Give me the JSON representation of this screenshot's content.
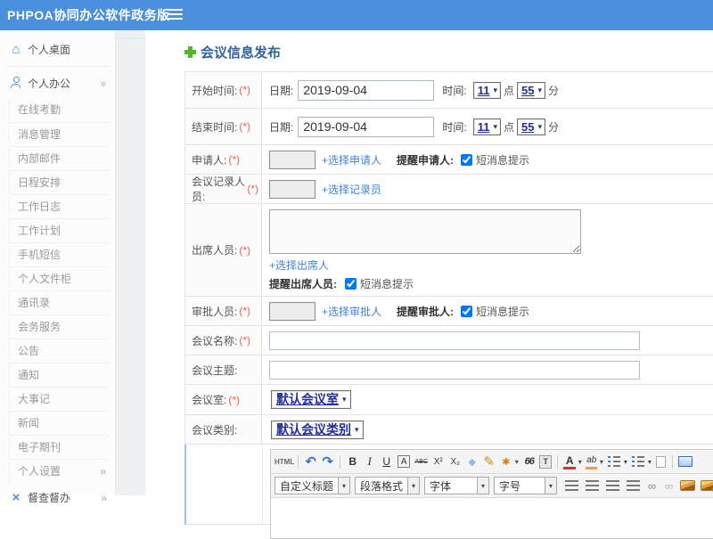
{
  "topbar": {
    "title": "PHPOA协同办公软件政务版"
  },
  "colors": {
    "header_blue": "#4a90dc",
    "link_blue": "#3f85d6",
    "required_red": "#f55a4e",
    "select_navy": "#232e9b",
    "sidebar_icon_blue": "#4a90d9",
    "supervise_pink": "#ee7f9a",
    "plus_green": "#55b42e",
    "title_blue": "#33639c"
  },
  "sidebar": {
    "desktop": {
      "label": "个人桌面"
    },
    "office": {
      "label": "个人办公"
    },
    "sub_items": [
      {
        "name": "sidebar-item-online-attendance",
        "label": "在线考勤"
      },
      {
        "name": "sidebar-item-message-management",
        "label": "消息管理"
      },
      {
        "name": "sidebar-item-internal-mail",
        "label": "内部邮件"
      },
      {
        "name": "sidebar-item-schedule",
        "label": "日程安排"
      },
      {
        "name": "sidebar-item-work-log",
        "label": "工作日志"
      },
      {
        "name": "sidebar-item-work-plan",
        "label": "工作计划"
      },
      {
        "name": "sidebar-item-mobile-sms",
        "label": "手机短信"
      },
      {
        "name": "sidebar-item-personal-cabinet",
        "label": "个人文件柜"
      },
      {
        "name": "sidebar-item-contacts",
        "label": "通讯录"
      },
      {
        "name": "sidebar-item-meeting-service",
        "label": "会务服务"
      },
      {
        "name": "sidebar-item-announcement",
        "label": "公告"
      },
      {
        "name": "sidebar-item-notice",
        "label": "通知"
      },
      {
        "name": "sidebar-item-memorabilia",
        "label": "大事记"
      },
      {
        "name": "sidebar-item-news",
        "label": "新闻"
      },
      {
        "name": "sidebar-item-e-journal",
        "label": "电子期刊"
      }
    ],
    "settings": {
      "label": "个人设置"
    },
    "supervise": {
      "label": "督查督办"
    }
  },
  "page": {
    "title": "会议信息发布"
  },
  "form": {
    "start_time": {
      "label": "开始时间:",
      "required": "(*)",
      "date_label": "日期:",
      "date_value": "2019-09-04",
      "time_label": "时间:",
      "hour": "11",
      "hour_unit": "点",
      "minute": "55",
      "minute_unit": "分"
    },
    "end_time": {
      "label": "结束时间:",
      "required": "(*)",
      "date_label": "日期:",
      "date_value": "2019-09-04",
      "time_label": "时间:",
      "hour": "11",
      "hour_unit": "点",
      "minute": "55",
      "minute_unit": "分"
    },
    "applicant": {
      "label": "申请人:",
      "required": "(*)",
      "value": "",
      "link": "+选择申请人",
      "remind_label": "提醒申请人:",
      "sms_label": "短消息提示",
      "checked": true
    },
    "recorder": {
      "label": "会议记录人员:",
      "required": "(*)",
      "value": "",
      "link": "+选择记录员"
    },
    "attendees": {
      "label": "出席人员:",
      "required": "(*)",
      "value": "",
      "link": "+选择出席人",
      "remind_label": "提醒出席人员:",
      "sms_label": "短消息提示",
      "checked": true
    },
    "approver": {
      "label": "审批人员:",
      "required": "(*)",
      "value": "",
      "link": "+选择审批人",
      "remind_label": "提醒审批人:",
      "sms_label": "短消息提示",
      "checked": true
    },
    "meeting_name": {
      "label": "会议名称:",
      "required": "(*)",
      "value": ""
    },
    "meeting_subject": {
      "label": "会议主题:",
      "value": ""
    },
    "meeting_room": {
      "label": "会议室:",
      "required": "(*)",
      "value": "默认会议室"
    },
    "meeting_category": {
      "label": "会议类别:",
      "value": "默认会议类别"
    }
  },
  "editor": {
    "selects": {
      "heading": "自定义标题",
      "paragraph": "段落格式",
      "font": "字体",
      "size": "字号"
    },
    "toolbar_row1": [
      {
        "name": "html-source-button",
        "glyph": "HTML",
        "cls": "tb-html"
      },
      {
        "type": "sep",
        "name": "toolbar-separator"
      },
      {
        "name": "undo-icon",
        "glyph": "↶",
        "cls": "tb-big",
        "color": "#2f6fc1"
      },
      {
        "name": "redo-icon",
        "glyph": "↷",
        "cls": "tb-big",
        "color": "#2f6fc1"
      },
      {
        "type": "sep",
        "name": "toolbar-separator"
      },
      {
        "name": "bold-icon",
        "glyph": "B",
        "cls": "tb-b"
      },
      {
        "name": "italic-icon",
        "glyph": "I",
        "cls": "tb-i"
      },
      {
        "name": "underline-icon",
        "glyph": "U",
        "cls": "tb-u"
      },
      {
        "name": "font-style-icon",
        "glyph": "A",
        "cls": "tb-boxA"
      },
      {
        "name": "strikethrough-icon",
        "glyph": "ABC",
        "cls": "tb-strike"
      },
      {
        "name": "superscript-icon",
        "glyph": "X²",
        "cls": "tb-small"
      },
      {
        "name": "subscript-icon",
        "glyph": "X₂",
        "cls": "tb-small"
      },
      {
        "name": "eraser-icon",
        "glyph": "◆",
        "color": "#93b9e2"
      },
      {
        "name": "format-brush-icon",
        "glyph": "✎",
        "cls": "tb-big",
        "color": "#cf8a1d"
      },
      {
        "name": "quick-format-icon",
        "glyph": "✱",
        "color": "#e07820"
      },
      {
        "name": "quick-format-caret",
        "glyph": "▾",
        "cls": "tb-caret"
      },
      {
        "name": "blockquote-icon",
        "glyph": "66",
        "cls": "tb-quote"
      },
      {
        "name": "paste-icon",
        "glyph": "T",
        "cls": "ic-paste"
      },
      {
        "type": "sep",
        "name": "toolbar-separator"
      },
      {
        "name": "font-color-icon",
        "glyph": "A",
        "cls": "tb-Acolor"
      },
      {
        "name": "font-color-caret",
        "glyph": "▾",
        "cls": "tb-caret"
      },
      {
        "name": "highlight-icon",
        "glyph": "ab",
        "cls": "tb-ab"
      },
      {
        "name": "highlight-caret",
        "glyph": "▾",
        "cls": "tb-caret"
      },
      {
        "name": "ordered-list-icon",
        "cls": "ic-olist"
      },
      {
        "name": "ordered-list-caret",
        "glyph": "▾",
        "cls": "tb-caret"
      },
      {
        "name": "unordered-list-icon",
        "cls": "ic-ulist"
      },
      {
        "name": "unordered-list-caret",
        "glyph": "▾",
        "cls": "tb-caret"
      },
      {
        "name": "new-page-icon",
        "cls": "ic-page"
      },
      {
        "type": "sep",
        "name": "toolbar-separator"
      },
      {
        "name": "fullscreen-icon",
        "cls": "ic-screen"
      }
    ],
    "toolbar_row2_icons": [
      {
        "name": "align-left-icon",
        "cls": "ic-align"
      },
      {
        "name": "align-center-icon",
        "cls": "ic-align"
      },
      {
        "name": "align-right-icon",
        "cls": "ic-align"
      },
      {
        "name": "align-justify-icon",
        "cls": "ic-align"
      },
      {
        "name": "link-icon",
        "glyph": "∞",
        "cls": "ic-link"
      },
      {
        "name": "unlink-icon",
        "glyph": "∞",
        "cls": "ic-link tb-dim"
      },
      {
        "name": "image-icon",
        "cls": "ic-img"
      },
      {
        "name": "image-upload-icon",
        "cls": "ic-img2"
      },
      {
        "name": "media-icon",
        "cls": "ic-media"
      },
      {
        "name": "table-icon",
        "cls": "ic-table"
      }
    ]
  }
}
